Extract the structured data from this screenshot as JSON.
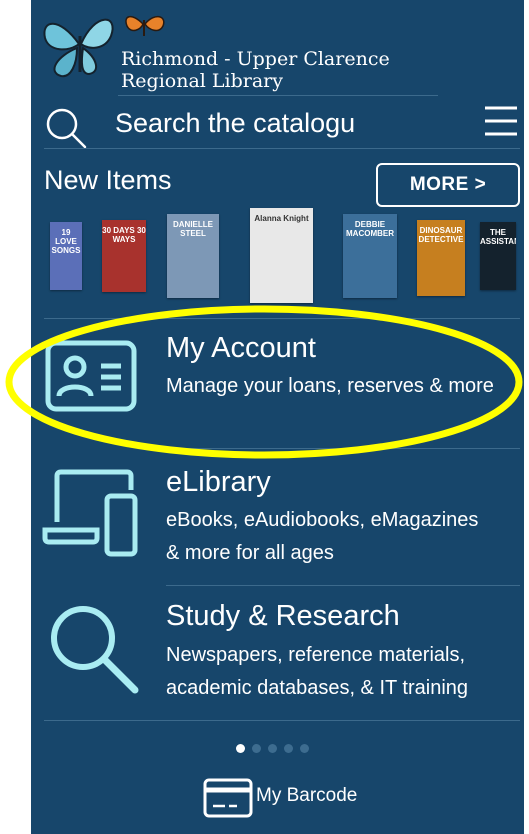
{
  "header": {
    "library_name_line1": "Richmond - Upper Clarence",
    "library_name_line2": "Regional Library",
    "logo_icon": "butterfly-logo-icon"
  },
  "search": {
    "placeholder": "Search the catalogu",
    "search_icon": "search-icon",
    "menu_icon": "hamburger-menu-icon"
  },
  "new_items": {
    "title": "New Items",
    "more_label": "MORE >",
    "covers": [
      {
        "text": "19 LOVE SONGS",
        "color": "#5b6fb8"
      },
      {
        "text": "30 DAYS 30 WAYS",
        "color": "#a8322d"
      },
      {
        "text": "DANIELLE STEEL",
        "color": "#7d98b6"
      },
      {
        "text": "Alanna Knight",
        "color": "#e8e8e8"
      },
      {
        "text": "DEBBIE MACOMBER",
        "color": "#3c6f9a"
      },
      {
        "text": "DINOSAUR DETECTIVE",
        "color": "#c67f1f"
      },
      {
        "text": "THE ASSISTANT",
        "color": "#14222d"
      }
    ]
  },
  "menu": [
    {
      "title": "My Account",
      "subtitle_line1": "Manage your loans, reserves & more",
      "subtitle_line2": "",
      "icon": "id-card-icon"
    },
    {
      "title": "eLibrary",
      "subtitle_line1": "eBooks, eAudiobooks, eMagazines",
      "subtitle_line2": "& more for all ages",
      "icon": "devices-icon"
    },
    {
      "title": "Study & Research",
      "subtitle_line1": "Newspapers, reference materials,",
      "subtitle_line2": "academic databases, & IT training",
      "icon": "magnifier-icon"
    }
  ],
  "pagination": {
    "count": 5,
    "active_index": 0
  },
  "footer": {
    "barcode_label": "My Barcode",
    "barcode_icon": "barcode-card-icon"
  },
  "colors": {
    "background": "#17466b",
    "icon_accent": "#a9ecf2",
    "highlight": "#ffff00"
  }
}
